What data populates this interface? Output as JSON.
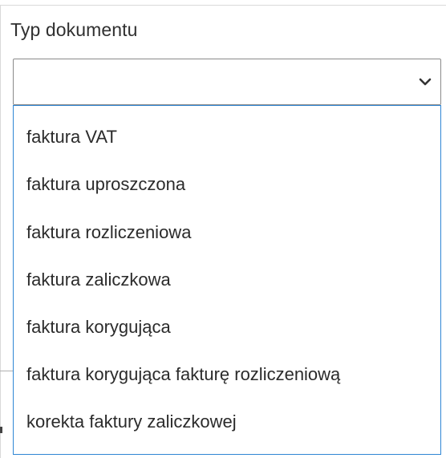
{
  "field": {
    "label": "Typ dokumentu",
    "selected_value": ""
  },
  "icons": {
    "chevron": "chevron-down-icon"
  },
  "colors": {
    "dropdown_border": "#2f86d4",
    "select_border": "#8a8a8a",
    "text": "#2b2b2b"
  },
  "options": [
    "faktura VAT",
    "faktura uproszczona",
    "faktura rozliczeniowa",
    "faktura zaliczkowa",
    "faktura korygująca",
    "faktura korygująca fakturę rozliczeniową",
    "korekta faktury zaliczkowej"
  ]
}
